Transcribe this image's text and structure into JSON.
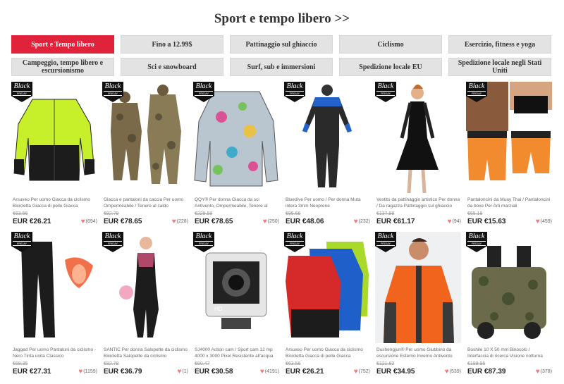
{
  "section_title": "Sport e tempo libero >>",
  "categories": [
    {
      "label": "Sport e Tempo libero",
      "active": true
    },
    {
      "label": "Fino a 12.99$",
      "active": false
    },
    {
      "label": "Pattinaggio sul ghiaccio",
      "active": false
    },
    {
      "label": "Ciclismo",
      "active": false
    },
    {
      "label": "Esercizio, fitness e yoga",
      "active": false
    },
    {
      "label": "Campeggio, tempo libero e escursionismo",
      "active": false
    },
    {
      "label": "Sci e snowboard",
      "active": false
    },
    {
      "label": "Surf, sub e immersioni",
      "active": false
    },
    {
      "label": "Spedizione locale EU",
      "active": false
    },
    {
      "label": "Spedizione locale negli Stati Uniti",
      "active": false
    }
  ],
  "badge": {
    "line1": "Black",
    "line2": "FRIDAY"
  },
  "colors": {
    "accent": "#e0223a",
    "heart": "#f07b7b"
  },
  "products": [
    {
      "title": "Arsuxeo Per uomo Giacca da ciclismo Bicicletta Giacca di pelle Giacca invernale",
      "old_price": "€63.56",
      "price": "EUR €26.21",
      "likes": "(694)",
      "image": "yellow-cycling-jacket"
    },
    {
      "title": "Giacca e pantaloni da caccia Per uomo Ompermeabile / Tenere al caldo",
      "old_price": "€82.79",
      "price": "EUR €78.65",
      "likes": "(228)",
      "image": "camo-hunting-suit"
    },
    {
      "title": "QQY® Per donna Giacca da sci Antivento, Ompermeabile, Tenere al caldo",
      "old_price": "€229.59",
      "price": "EUR €78.65",
      "likes": "(250)",
      "image": "floral-ski-jacket"
    },
    {
      "title": "Bluedive Per uomo / Per donna Muta intera 3mm Neoprene",
      "old_price": "€95.66",
      "price": "EUR €48.06",
      "likes": "(232)",
      "image": "wetsuit"
    },
    {
      "title": "Vestito da pattinaggio artistico Per donna / Da ragazza Pattinaggio sul ghiaccio",
      "old_price": "€137.98",
      "price": "EUR €61.17",
      "likes": "(94)",
      "image": "skating-dress"
    },
    {
      "title": "Pantaloncini da Muay Thai / Pantaloncini da boxe Per Arti marziali",
      "old_price": "€65.18",
      "price": "EUR €15.63",
      "likes": "(459)",
      "image": "muay-thai-shorts"
    },
    {
      "title": "Jagged Per uomo Pantaloni da ciclismo - Nero Tinta unita Classico",
      "old_price": "€68.35",
      "price": "EUR €27.31",
      "likes": "(1159)",
      "image": "cycling-pants"
    },
    {
      "title": "SANTIC Per donna Salopette da ciclismo Bicicletta Salopette da ciclismo",
      "old_price": "€82.78",
      "price": "EUR €36.79",
      "likes": "(1)",
      "image": "cycling-bib"
    },
    {
      "title": "SJ4000 Action cam / Sport cam 12 mp 4000 x 3000 Pixel Resistente all'acqua",
      "old_price": "€60.47",
      "price": "EUR €30.58",
      "likes": "(4191)",
      "image": "action-camera"
    },
    {
      "title": "Arsuxeo Per uomo Giacca da ciclismo Bicicletta Giacca di pelle Giacca invernale",
      "old_price": "€63.56",
      "price": "EUR €26.21",
      "likes": "(752)",
      "image": "cycling-jackets"
    },
    {
      "title": "Dushengjun® Per uomo Giubbino da escursione Esterno Inverno Antivento",
      "old_price": "€121.82",
      "price": "EUR €34.95",
      "likes": "(539)",
      "image": "orange-jacket"
    },
    {
      "title": "Boshile 10 X 50 mm Binocolo / Interfaccia di ricerca Visione notturna",
      "old_price": "€189.95",
      "price": "EUR €87.39",
      "likes": "(378)",
      "image": "binoculars"
    }
  ]
}
